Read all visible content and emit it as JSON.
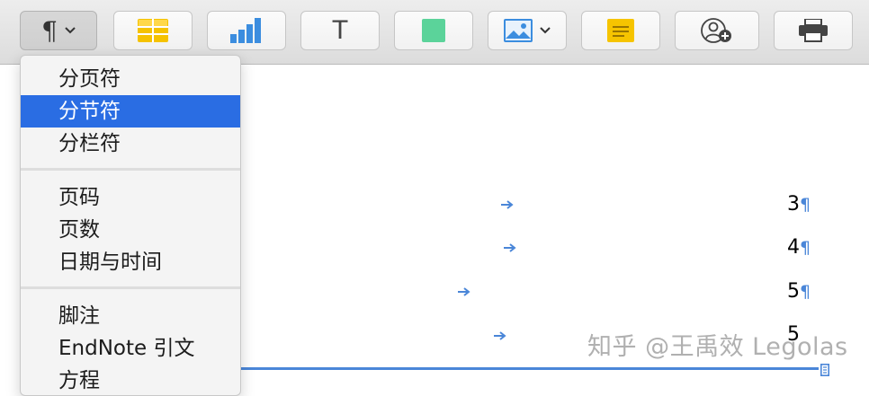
{
  "toolbar": {
    "buttons": [
      {
        "name": "paragraph-format-button",
        "icon": "pilcrow-icon",
        "glyph": "¶",
        "has_chevron": true,
        "active": true
      },
      {
        "name": "table-button",
        "icon": "table-icon"
      },
      {
        "name": "chart-button",
        "icon": "bar-chart-icon"
      },
      {
        "name": "text-box-button",
        "icon": "text-icon",
        "glyph": "T"
      },
      {
        "name": "shape-button",
        "icon": "square-shape-icon"
      },
      {
        "name": "media-button",
        "icon": "image-icon",
        "has_chevron": true
      },
      {
        "name": "comment-button",
        "icon": "sticky-note-icon"
      },
      {
        "name": "collaborate-button",
        "icon": "add-person-icon"
      },
      {
        "name": "print-button",
        "icon": "printer-icon"
      }
    ]
  },
  "insert_menu": {
    "groups": [
      {
        "items": [
          {
            "label": "分页符",
            "selected": false
          },
          {
            "label": "分节符",
            "selected": true
          },
          {
            "label": "分栏符",
            "selected": false
          }
        ]
      },
      {
        "items": [
          {
            "label": "页码",
            "selected": false
          },
          {
            "label": "页数",
            "selected": false
          },
          {
            "label": "日期与时间",
            "selected": false
          }
        ]
      },
      {
        "items": [
          {
            "label": "脚注",
            "selected": false
          },
          {
            "label": "EndNote 引文",
            "selected": false
          },
          {
            "label": "方程",
            "selected": false
          }
        ]
      }
    ]
  },
  "document": {
    "toc_entries": [
      {
        "page": "3",
        "mark": "¶"
      },
      {
        "page": "4",
        "mark": "¶"
      },
      {
        "page": "5",
        "mark": "¶"
      },
      {
        "page": "5",
        "mark": ""
      }
    ],
    "watermark": "知乎 @王禹效 Legolas"
  },
  "colors": {
    "accent": "#2a6de3",
    "invisibles": "#4a86d8"
  }
}
